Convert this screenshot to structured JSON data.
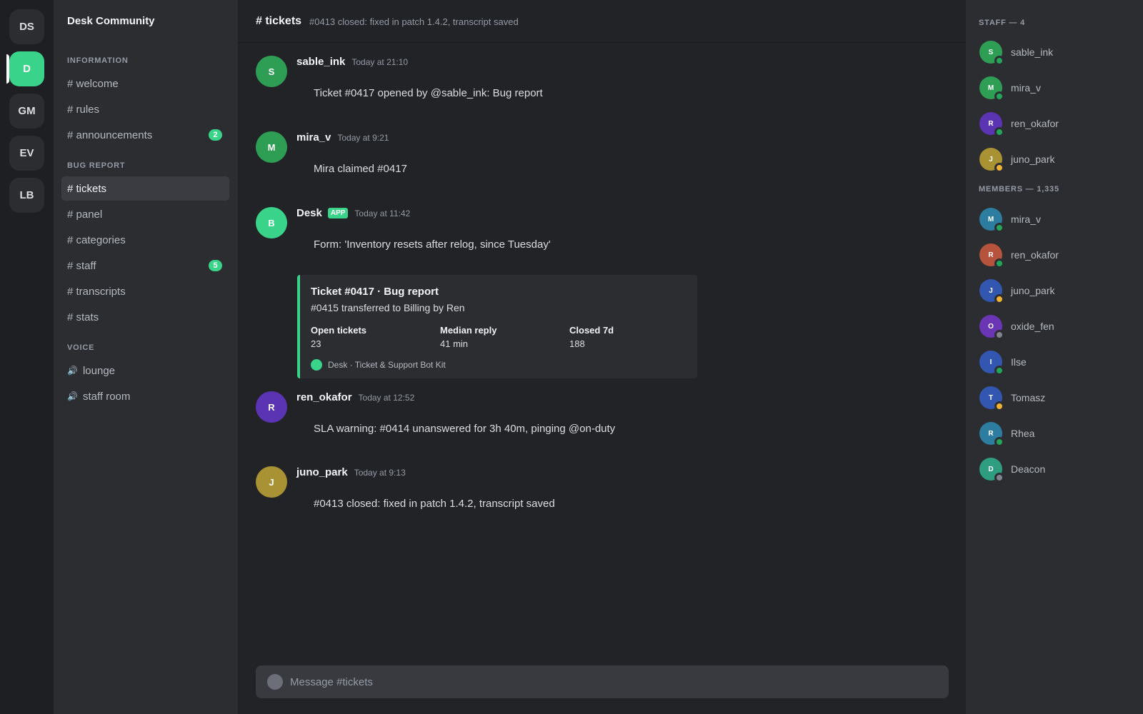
{
  "servers": [
    {
      "label": "DS",
      "active": false
    },
    {
      "label": "D",
      "active": true
    },
    {
      "label": "GM",
      "active": false
    },
    {
      "label": "EV",
      "active": false
    },
    {
      "label": "LB",
      "active": false
    }
  ],
  "sidebar": {
    "server_name": "Desk Community",
    "sections": {
      "information": "INFORMATION",
      "bug_report": "BUG REPORT",
      "voice": "VOICE"
    },
    "channels": [
      {
        "label": "# welcome"
      },
      {
        "label": "# rules"
      },
      {
        "label": "# announcements",
        "badge": "2"
      },
      {
        "label": "# tickets",
        "active": true
      },
      {
        "label": "# panel"
      },
      {
        "label": "# categories"
      },
      {
        "label": "# staff",
        "badge": "5"
      },
      {
        "label": "# transcripts"
      },
      {
        "label": "# stats"
      }
    ],
    "voice_channels": [
      {
        "icon": "speaker-icon",
        "glyph": "🔊",
        "label": "lounge"
      },
      {
        "icon": "speaker-icon",
        "glyph": "🔊",
        "label": "staff room"
      }
    ]
  },
  "header": {
    "title": "# tickets",
    "topic": "#0413 closed: fixed in patch 1.4.2, transcript saved"
  },
  "messages": [
    {
      "initial": "S",
      "color": "#2f9e55",
      "author": "sable_ink",
      "timestamp": "Today at 21:10",
      "text": "Ticket #0417 opened by @sable_ink: Bug report"
    },
    {
      "initial": "M",
      "color": "#2f9e55",
      "author": "mira_v",
      "timestamp": "Today at 9:21",
      "text": "Mira claimed #0417"
    },
    {
      "initial": "B",
      "color": "#3ad38a",
      "author": "Desk",
      "tag": "APP",
      "timestamp": "Today at 11:42",
      "text": "Form: 'Inventory resets after relog, since Tuesday'"
    },
    {
      "initial": "R",
      "color": "#5b34b3",
      "author": "ren_okafor",
      "timestamp": "Today at 12:52",
      "text": "SLA warning: #0414 unanswered for 3h 40m, pinging @on-duty"
    },
    {
      "initial": "J",
      "color": "#a89233",
      "author": "juno_park",
      "timestamp": "Today at 9:13",
      "text": "#0413 closed: fixed in patch 1.4.2, transcript saved"
    }
  ],
  "embed": {
    "accent": "#3ad38a",
    "title": "Ticket #0417 · Bug report",
    "description": "#0415 transferred to Billing by Ren",
    "fields": [
      {
        "name": "Open tickets",
        "value": "23"
      },
      {
        "name": "Median reply",
        "value": "41 min"
      },
      {
        "name": "Closed 7d",
        "value": "188"
      }
    ],
    "footer": "Desk · Ticket & Support Bot Kit"
  },
  "composer": {
    "placeholder": "Message #tickets",
    "attach_icon": "plus-circle-icon"
  },
  "members": {
    "staff_header": "STAFF — 4",
    "staff": [
      {
        "initial": "S",
        "name": "sable_ink",
        "color": "#2f9e55",
        "status": "online"
      },
      {
        "initial": "M",
        "name": "mira_v",
        "color": "#2f9e55",
        "status": "online"
      },
      {
        "initial": "R",
        "name": "ren_okafor",
        "color": "#5b34b3",
        "status": "online"
      },
      {
        "initial": "J",
        "name": "juno_park",
        "color": "#a89233",
        "status": "idle"
      }
    ],
    "members_header": "MEMBERS — 1,335",
    "members": [
      {
        "initial": "M",
        "name": "mira_v",
        "color": "#2d7da0",
        "status": "online"
      },
      {
        "initial": "R",
        "name": "ren_okafor",
        "color": "#b5533c",
        "status": "online"
      },
      {
        "initial": "J",
        "name": "juno_park",
        "color": "#3357b0",
        "status": "idle"
      },
      {
        "initial": "O",
        "name": "oxide_fen",
        "color": "#6a36b5",
        "status": "offline"
      },
      {
        "initial": "I",
        "name": "Ilse",
        "color": "#3357b0",
        "status": "online"
      },
      {
        "initial": "T",
        "name": "Tomasz",
        "color": "#3357b0",
        "status": "idle"
      },
      {
        "initial": "R",
        "name": "Rhea",
        "color": "#2d7da0",
        "status": "online"
      },
      {
        "initial": "D",
        "name": "Deacon",
        "color": "#2f9e80",
        "status": "offline"
      }
    ]
  },
  "status_colors": {
    "online": "#23a55a",
    "idle": "#f0b232",
    "offline": "#80848e"
  }
}
